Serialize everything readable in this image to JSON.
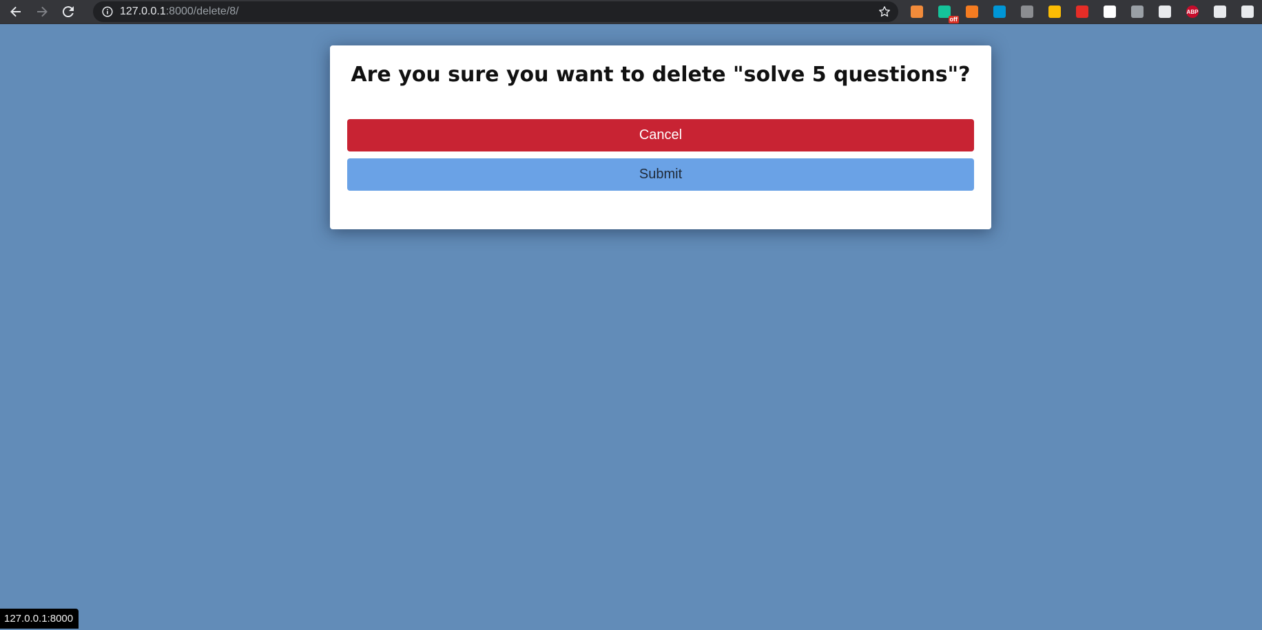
{
  "browser": {
    "url_host": "127.0.0.1",
    "url_path": ":8000/delete/8/",
    "extensions": [
      {
        "name": "ext-1-icon",
        "color": "#f28b3a"
      },
      {
        "name": "grammarly-icon",
        "color": "#15c39a",
        "badge": "off"
      },
      {
        "name": "screen-recorder-icon",
        "color": "#f57c21"
      },
      {
        "name": "hp-icon",
        "color": "#0096d6"
      },
      {
        "name": "ext-photo-icon",
        "color": "#8b8d91"
      },
      {
        "name": "ext-chrome-like-icon",
        "color": "#fbbc04"
      },
      {
        "name": "youtube-icon",
        "color": "#e52d27"
      },
      {
        "name": "notion-icon",
        "color": "#ffffff"
      },
      {
        "name": "mouse-icon",
        "color": "#9aa0a6"
      },
      {
        "name": "pen-icon",
        "color": "#e8eaed"
      },
      {
        "name": "adblock-plus-icon",
        "color": "#c70d2c",
        "label": "ABP"
      },
      {
        "name": "puzzle-icon",
        "color": "#e8eaed"
      },
      {
        "name": "media-queue-icon",
        "color": "#e8eaed"
      }
    ]
  },
  "dialog": {
    "title": "Are you sure you want to delete \"solve 5 questions\"?",
    "cancel_label": "Cancel",
    "submit_label": "Submit"
  },
  "status_bar": {
    "text": "127.0.0.1:8000"
  },
  "colors": {
    "page_background": "#628cb8",
    "cancel": "#c82333",
    "submit": "#6aa2e6"
  }
}
